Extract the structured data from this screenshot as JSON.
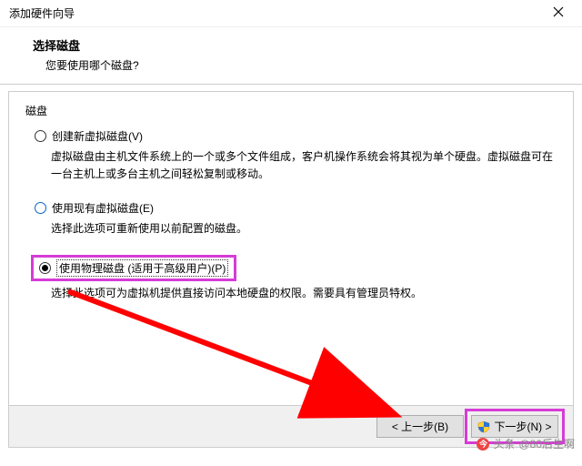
{
  "window": {
    "title": "添加硬件向导"
  },
  "header": {
    "title": "选择磁盘",
    "subtitle": "您要使用哪个磁盘?"
  },
  "section_label": "磁盘",
  "options": [
    {
      "label": "创建新虚拟磁盘(V)",
      "desc": "虚拟磁盘由主机文件系统上的一个或多个文件组成，客户机操作系统会将其视为单个硬盘。虚拟磁盘可在一台主机上或多台主机之间轻松复制或移动。",
      "selected": false,
      "highlighted": false
    },
    {
      "label": "使用现有虚拟磁盘(E)",
      "desc": "选择此选项可重新使用以前配置的磁盘。",
      "selected": false,
      "highlighted": false
    },
    {
      "label": "使用物理磁盘 (适用于高级用户)(P)",
      "desc": "选择此选项可为虚拟机提供直接访问本地硬盘的权限。需要具有管理员特权。",
      "selected": true,
      "highlighted": true
    }
  ],
  "buttons": {
    "back": "< 上一步(B)",
    "next": "下一步(N) >",
    "next_highlighted": true
  },
  "watermark": {
    "brand": "头条",
    "text": "@80后生啊"
  },
  "accent_colors": {
    "highlight": "#d63cd6",
    "arrow": "#ff0000"
  }
}
